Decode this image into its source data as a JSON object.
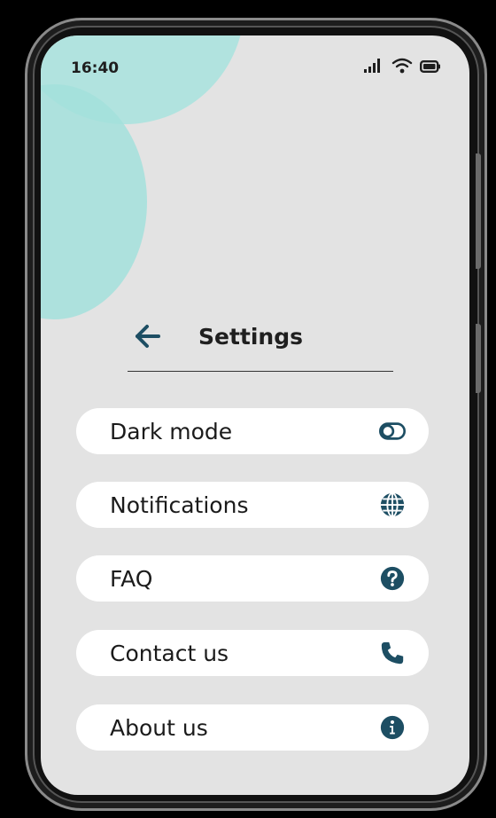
{
  "status_bar": {
    "time": "16:40",
    "icons": [
      "signal-icon",
      "wifi-icon",
      "battery-icon"
    ]
  },
  "header": {
    "title": "Settings",
    "back_icon": "back-arrow-icon"
  },
  "menu": {
    "items": [
      {
        "label": "Dark mode",
        "icon": "toggle-icon"
      },
      {
        "label": "Notifications",
        "icon": "globe-icon"
      },
      {
        "label": "FAQ",
        "icon": "question-icon"
      },
      {
        "label": "Contact us",
        "icon": "phone-icon"
      },
      {
        "label": "About us",
        "icon": "info-icon"
      }
    ]
  },
  "colors": {
    "accent": "#1d4e63",
    "screen_bg": "#e3e3e3",
    "blob": "#a8e3de",
    "item_bg": "#ffffff"
  }
}
